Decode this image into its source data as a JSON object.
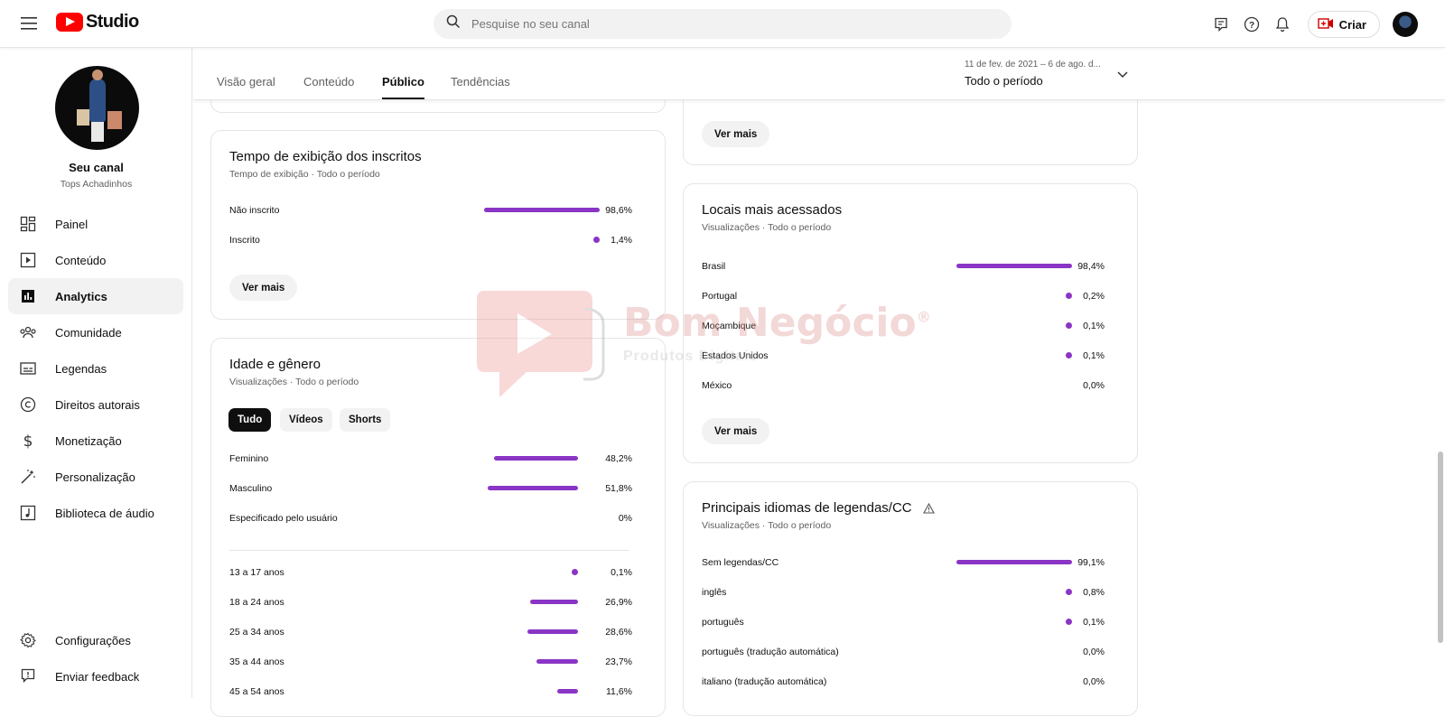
{
  "header": {
    "logo_text": "Studio",
    "search_placeholder": "Pesquise no seu canal",
    "create_label": "Criar"
  },
  "sidebar": {
    "channel_name": "Seu canal",
    "channel_handle": "Tops Achadinhos",
    "items": [
      {
        "label": "Painel",
        "icon": "dashboard-icon"
      },
      {
        "label": "Conteúdo",
        "icon": "content-icon"
      },
      {
        "label": "Analytics",
        "icon": "analytics-icon"
      },
      {
        "label": "Comunidade",
        "icon": "community-icon"
      },
      {
        "label": "Legendas",
        "icon": "subtitles-icon"
      },
      {
        "label": "Direitos autorais",
        "icon": "copyright-icon"
      },
      {
        "label": "Monetização",
        "icon": "monetization-icon"
      },
      {
        "label": "Personalização",
        "icon": "customization-icon"
      },
      {
        "label": "Biblioteca de áudio",
        "icon": "audio-library-icon"
      }
    ],
    "bottom_items": [
      {
        "label": "Configurações",
        "icon": "settings-icon"
      },
      {
        "label": "Enviar feedback",
        "icon": "feedback-icon"
      }
    ]
  },
  "tabs": [
    {
      "label": "Visão geral"
    },
    {
      "label": "Conteúdo"
    },
    {
      "label": "Público"
    },
    {
      "label": "Tendências"
    }
  ],
  "active_tab": "Público",
  "date_range": {
    "range": "11 de fev. de 2021 – 6 de ago. d...",
    "label": "Todo o período"
  },
  "buttons": {
    "see_more": "Ver mais"
  },
  "subscribers_watch": {
    "title": "Tempo de exibição dos inscritos",
    "subtitle": "Tempo de exibição · Todo o período",
    "rows": [
      {
        "label": "Não inscrito",
        "value": "98,6%",
        "pct": 98.6
      },
      {
        "label": "Inscrito",
        "value": "1,4%",
        "pct": 1.4
      }
    ]
  },
  "age_gender": {
    "title": "Idade e gênero",
    "subtitle": "Visualizações · Todo o período",
    "chips": [
      "Tudo",
      "Vídeos",
      "Shorts"
    ],
    "active_chip": "Tudo",
    "gender_rows": [
      {
        "label": "Feminino",
        "value": "48,2%",
        "pct": 48.2
      },
      {
        "label": "Masculino",
        "value": "51,8%",
        "pct": 51.8
      },
      {
        "label": "Especificado pelo usuário",
        "value": "0%",
        "pct": 0
      }
    ],
    "age_rows": [
      {
        "label": "13 a 17 anos",
        "value": "0,1%",
        "pct": 0.1
      },
      {
        "label": "18 a 24 anos",
        "value": "26,9%",
        "pct": 26.9
      },
      {
        "label": "25 a 34 anos",
        "value": "28,6%",
        "pct": 28.6
      },
      {
        "label": "35 a 44 anos",
        "value": "23,7%",
        "pct": 23.7
      },
      {
        "label": "45 a 54 anos",
        "value": "11,6%",
        "pct": 11.6
      }
    ]
  },
  "top_locations": {
    "title": "Locais mais acessados",
    "subtitle": "Visualizações · Todo o período",
    "rows": [
      {
        "label": "Brasil",
        "value": "98,4%",
        "pct": 98.4
      },
      {
        "label": "Portugal",
        "value": "0,2%",
        "pct": 0.2
      },
      {
        "label": "Moçambique",
        "value": "0,1%",
        "pct": 0.1
      },
      {
        "label": "Estados Unidos",
        "value": "0,1%",
        "pct": 0.1
      },
      {
        "label": "México",
        "value": "0,0%",
        "pct": 0
      }
    ]
  },
  "subtitle_languages": {
    "title": "Principais idiomas de legendas/CC",
    "subtitle": "Visualizações · Todo o período",
    "rows": [
      {
        "label": "Sem legendas/CC",
        "value": "99,1%",
        "pct": 99.1
      },
      {
        "label": "inglês",
        "value": "0,8%",
        "pct": 0.8
      },
      {
        "label": "português",
        "value": "0,1%",
        "pct": 0.1
      },
      {
        "label": "português (tradução automática)",
        "value": "0,0%",
        "pct": 0
      },
      {
        "label": "italiano (tradução automática)",
        "value": "0,0%",
        "pct": 0
      }
    ]
  },
  "watermark": {
    "brand": "Bom Negócio",
    "tagline": "Produtos Digitais",
    "registered": "®"
  }
}
